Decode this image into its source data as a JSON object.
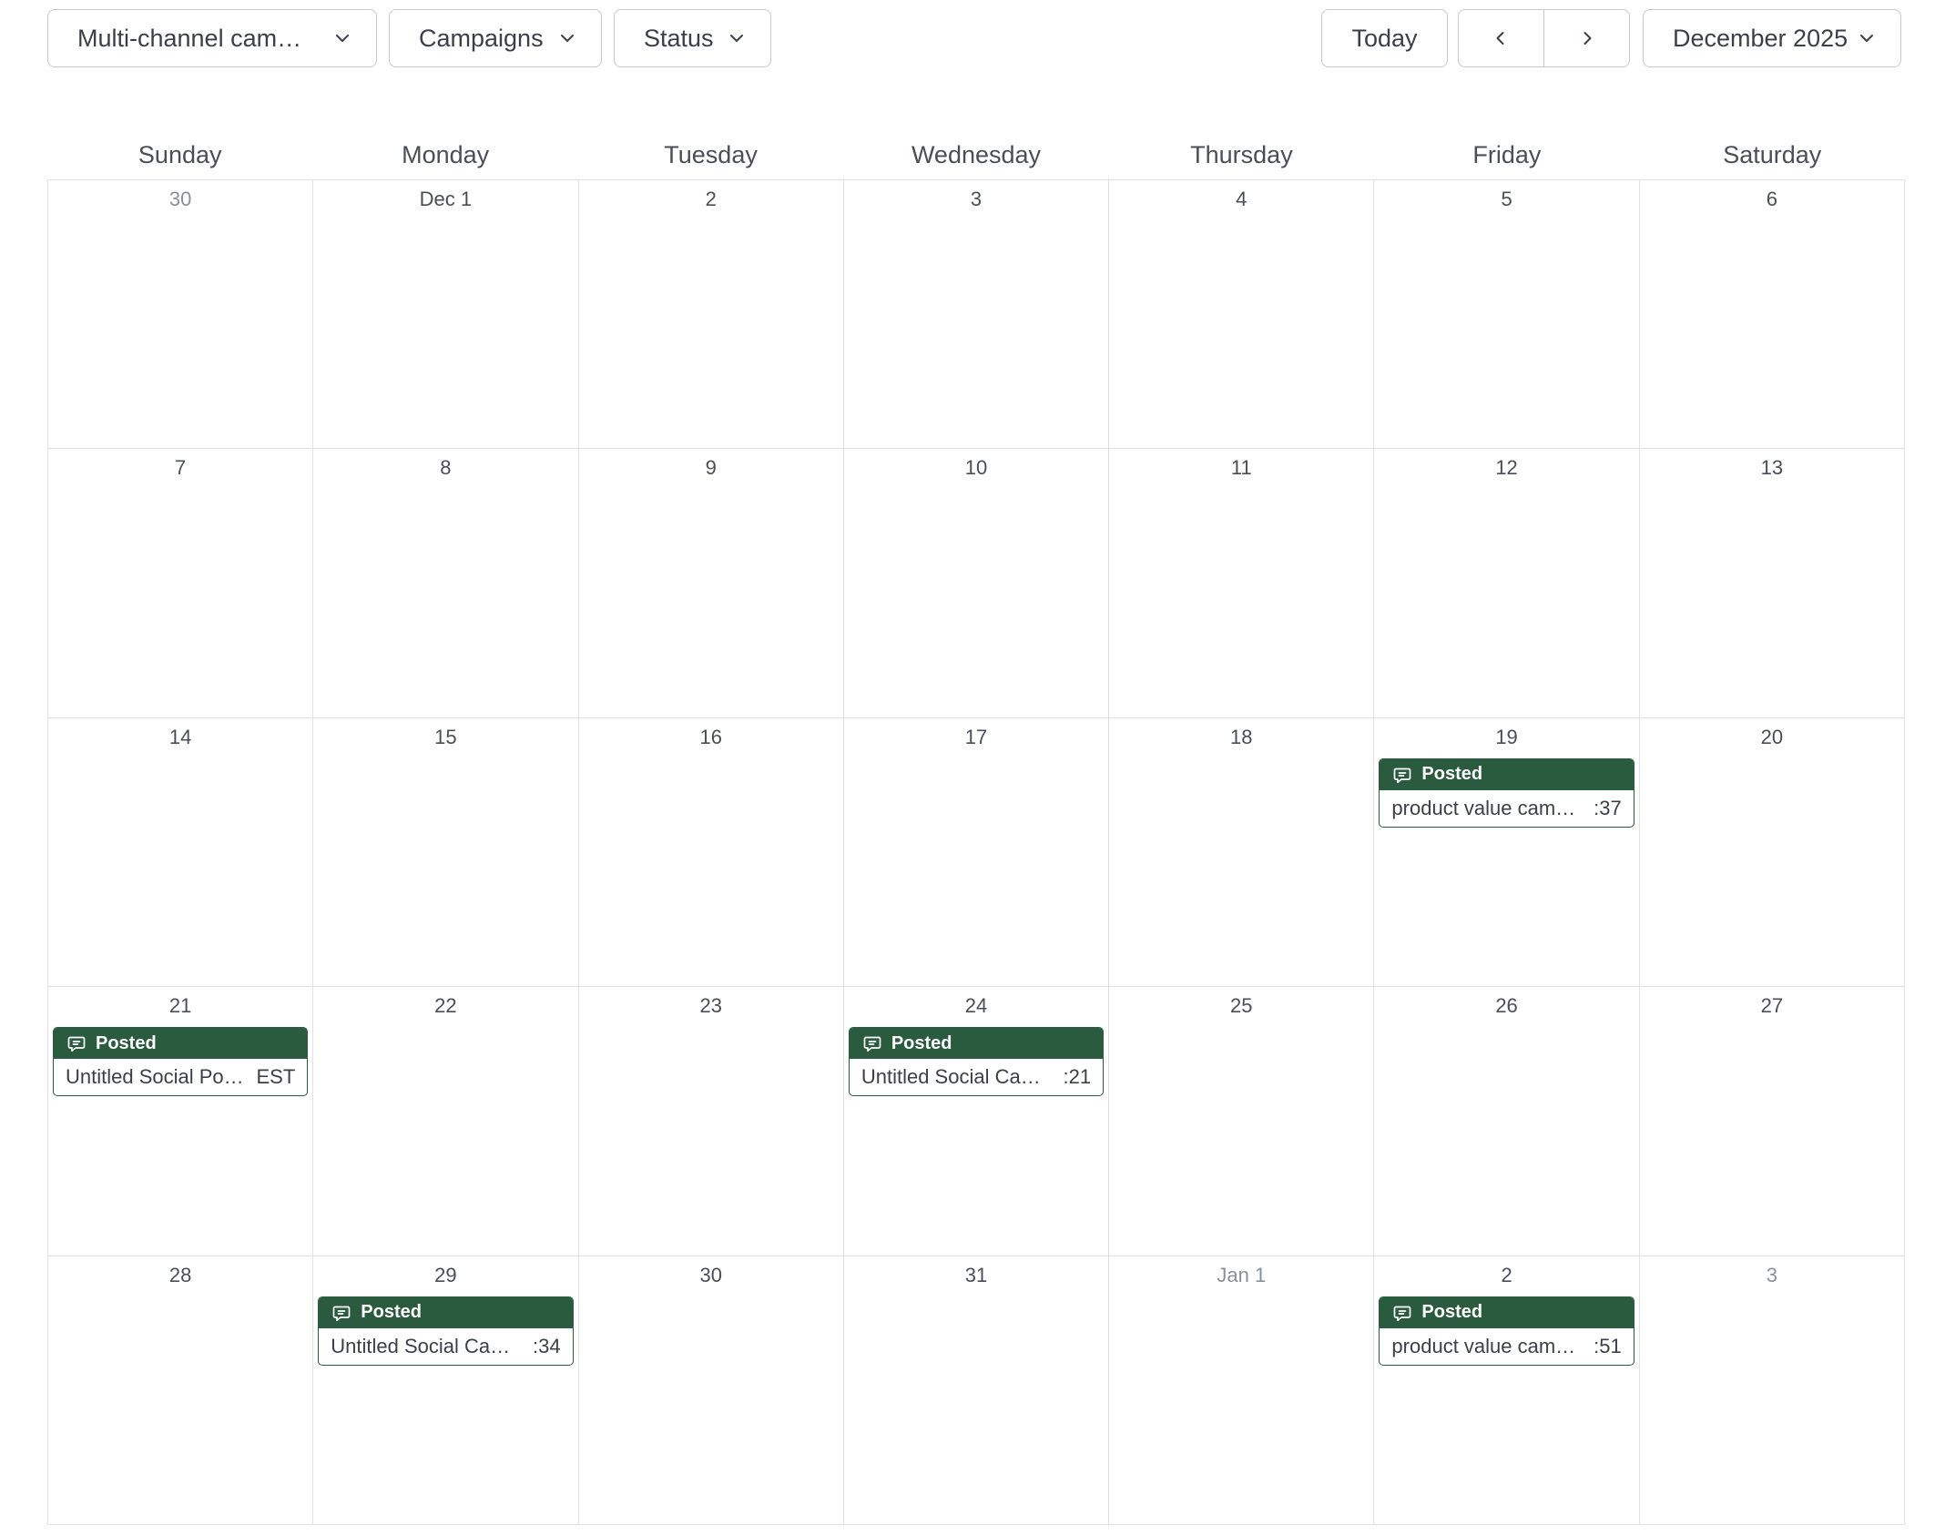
{
  "toolbar": {
    "filter_campaign_type": "Multi-channel cam…",
    "filter_campaigns": "Campaigns",
    "filter_status": "Status",
    "today_label": "Today",
    "month_selector": "December 2025"
  },
  "weekdays": [
    "Sunday",
    "Monday",
    "Tuesday",
    "Wednesday",
    "Thursday",
    "Friday",
    "Saturday"
  ],
  "weeks": [
    [
      {
        "label": "30",
        "muted": true
      },
      {
        "label": "Dec 1"
      },
      {
        "label": "2"
      },
      {
        "label": "3"
      },
      {
        "label": "4"
      },
      {
        "label": "5"
      },
      {
        "label": "6"
      }
    ],
    [
      {
        "label": "7"
      },
      {
        "label": "8"
      },
      {
        "label": "9"
      },
      {
        "label": "10"
      },
      {
        "label": "11"
      },
      {
        "label": "12"
      },
      {
        "label": "13"
      }
    ],
    [
      {
        "label": "14"
      },
      {
        "label": "15"
      },
      {
        "label": "16"
      },
      {
        "label": "17"
      },
      {
        "label": "18"
      },
      {
        "label": "19",
        "events": [
          {
            "status": "Posted",
            "title": "product value cam…",
            "time": ":37"
          }
        ]
      },
      {
        "label": "20"
      }
    ],
    [
      {
        "label": "21",
        "events": [
          {
            "status": "Posted",
            "title": "Untitled Social Po…",
            "time": "EST"
          }
        ]
      },
      {
        "label": "22"
      },
      {
        "label": "23"
      },
      {
        "label": "24",
        "events": [
          {
            "status": "Posted",
            "title": "Untitled Social Ca…",
            "time": ":21"
          }
        ]
      },
      {
        "label": "25"
      },
      {
        "label": "26"
      },
      {
        "label": "27"
      }
    ],
    [
      {
        "label": "28"
      },
      {
        "label": "29",
        "events": [
          {
            "status": "Posted",
            "title": "Untitled Social Ca…",
            "time": ":34"
          }
        ]
      },
      {
        "label": "30"
      },
      {
        "label": "31"
      },
      {
        "label": "Jan 1",
        "muted": true
      },
      {
        "label": "2",
        "events": [
          {
            "status": "Posted",
            "title": "product value cam…",
            "time": ":51"
          }
        ]
      },
      {
        "label": "3",
        "muted": true
      }
    ]
  ],
  "icons": {
    "chevron": "chevron-down-icon",
    "prev": "chevron-left-icon",
    "next": "chevron-right-icon",
    "event_status": "comment-icon"
  },
  "colors": {
    "posted_bg": "#2b5b3f",
    "border": "#c7c9ce",
    "grid": "#e1e2e5",
    "muted_text": "#8b8f96"
  }
}
